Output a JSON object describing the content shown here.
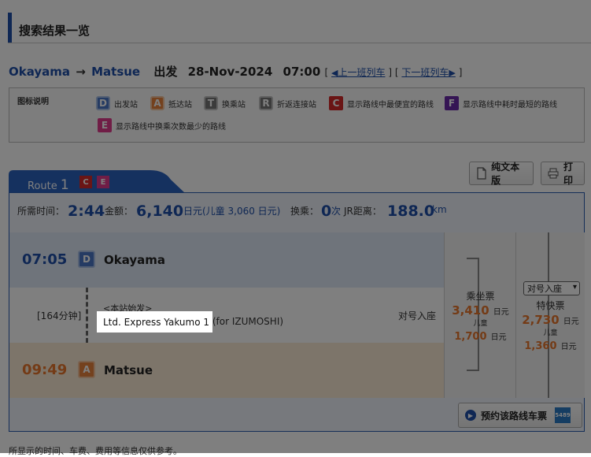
{
  "section_title": "搜索结果一览",
  "route_header": {
    "from": "Okayama",
    "arrow": "→",
    "to": "Matsue",
    "departure_label": "出发",
    "date": "28-Nov-2024",
    "time": "07:00",
    "bracket_open": "[",
    "bracket_close": "]",
    "prev_link": "上一班列车",
    "next_link": "下一班列车"
  },
  "legend": {
    "title": "图标说明",
    "items": [
      {
        "badge": "D",
        "label": "出发站"
      },
      {
        "badge": "A",
        "label": "抵达站"
      },
      {
        "badge": "T",
        "label": "换乘站"
      },
      {
        "badge": "R",
        "label": "折返连接站"
      },
      {
        "badge": "C",
        "label": "显示路线中最便宜的路线"
      },
      {
        "badge": "F",
        "label": "显示路线中耗时最短的路线"
      },
      {
        "badge": "E",
        "label": "显示路线中换乘次数最少的路线"
      }
    ]
  },
  "route_tab": {
    "label": "Route",
    "number": "1",
    "badges": [
      "C",
      "E"
    ]
  },
  "buttons": {
    "plain_text": "纯文本版",
    "print": "打印",
    "reserve": "预约该路线车票",
    "reserve_logo": "5489"
  },
  "summary": {
    "time_label": "所需时间：",
    "time_value": "2:44",
    "fare_label": "金额：",
    "fare_value": "6,140",
    "fare_unit": "日元(儿童 3,060 日元)",
    "transfer_label": "换乘：",
    "transfer_value": "0",
    "transfer_unit": "次",
    "distance_label": "JR距离：",
    "distance_value": "188.0",
    "distance_unit": "km"
  },
  "departure": {
    "time": "07:05",
    "badge": "D",
    "station": "Okayama"
  },
  "segment": {
    "duration": "[164分钟]",
    "note": "<本站始发>",
    "train": "Ltd. Express Yakumo 1",
    "train_dest": "(for IZUMOSHI)",
    "seat": "对号入座"
  },
  "arrival": {
    "time": "09:49",
    "badge": "A",
    "station": "Matsue"
  },
  "fares": {
    "basic": {
      "label": "乘坐票",
      "adult": "3,410",
      "unit": "日元",
      "child_label": "儿童",
      "child": "1,700"
    },
    "express": {
      "select_value": "对号入座",
      "label": "特快票",
      "adult": "2,730",
      "unit": "日元",
      "child_label": "儿童",
      "child": "1,360"
    }
  },
  "footnote": "所显示的时间、车费、费用等信息仅供参考。",
  "colors": {
    "accent_blue": "#1f4fa8",
    "orange": "#e8762c",
    "badge_C": "#d42a2a",
    "badge_F": "#6b2aa8",
    "badge_E": "#e03a8c"
  }
}
